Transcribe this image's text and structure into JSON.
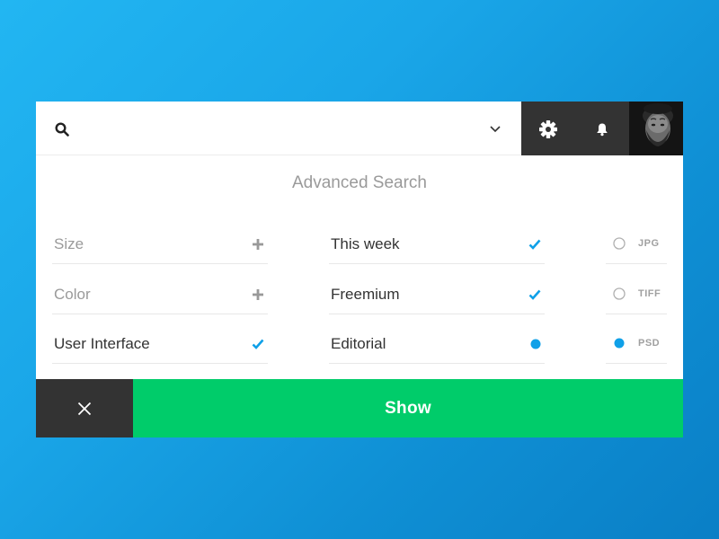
{
  "search": {
    "value": "",
    "placeholder": "",
    "icon": "search-icon",
    "dropdown_icon": "chevron-down-icon"
  },
  "toolbar": {
    "settings_icon": "gear-icon",
    "notifications_icon": "bell-icon",
    "avatar": "user-avatar"
  },
  "title": "Advanced Search",
  "filters": {
    "left": [
      {
        "label": "Size",
        "state": "add",
        "icon": "plus-icon"
      },
      {
        "label": "Color",
        "state": "add",
        "icon": "plus-icon"
      },
      {
        "label": "User Interface",
        "state": "checked",
        "icon": "check-icon"
      }
    ],
    "middle": [
      {
        "label": "This week",
        "state": "checked",
        "icon": "check-icon"
      },
      {
        "label": "Freemium",
        "state": "checked",
        "icon": "check-icon"
      },
      {
        "label": "Editorial",
        "state": "selected",
        "icon": "dot-icon"
      }
    ]
  },
  "formats": [
    {
      "label": "JPG",
      "selected": false
    },
    {
      "label": "TIFF",
      "selected": false
    },
    {
      "label": "PSD",
      "selected": true
    }
  ],
  "actions": {
    "close_icon": "close-icon",
    "show_label": "Show"
  },
  "colors": {
    "background": "#1aa6e8",
    "dark": "#333333",
    "accent_blue": "#0fa0e8",
    "show_green": "#00cc6a"
  }
}
